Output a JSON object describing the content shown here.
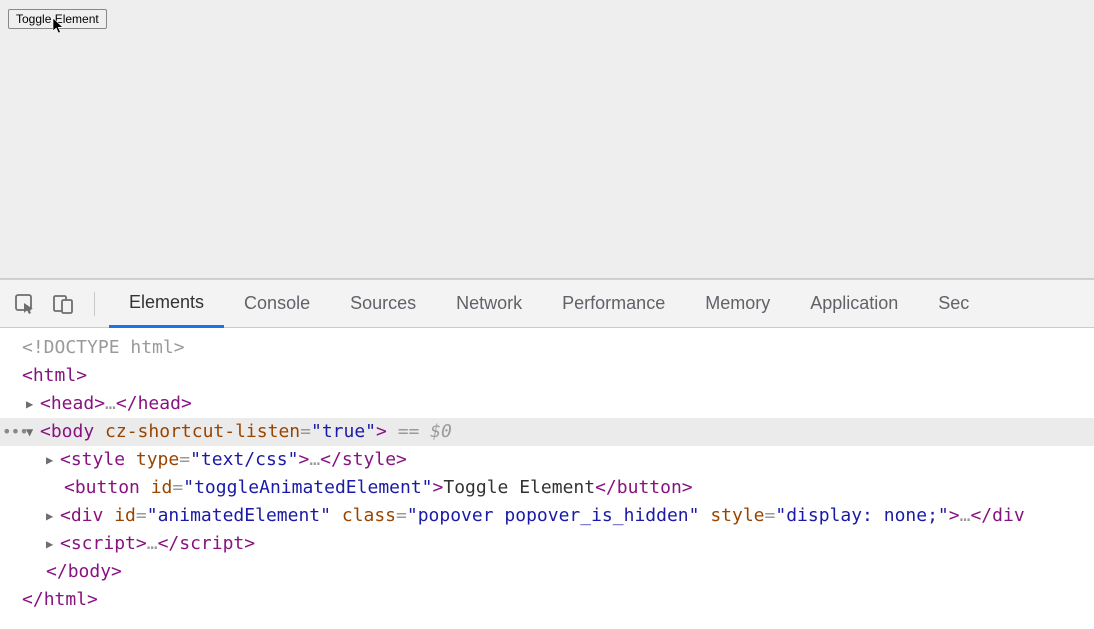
{
  "page": {
    "toggle_button_label": "Toggle Element"
  },
  "devtools": {
    "tabs": {
      "elements": "Elements",
      "console": "Console",
      "sources": "Sources",
      "network": "Network",
      "performance": "Performance",
      "memory": "Memory",
      "application": "Application",
      "security_partial": "Sec"
    },
    "active_tab": "Elements"
  },
  "dom": {
    "doctype": "<!DOCTYPE html>",
    "html_open": "html",
    "head_open": "head",
    "head_ellipsis": "…",
    "head_close": "head",
    "body_open": "body",
    "body_attr_name": "cz-shortcut-listen",
    "body_attr_value": "true",
    "selected_marker": " == $0",
    "style_tag": "style",
    "style_attr_name": "type",
    "style_attr_value": "text/css",
    "style_ellipsis": "…",
    "button_tag": "button",
    "button_id_attr": "id",
    "button_id_value": "toggleAnimatedElement",
    "button_text": "Toggle Element",
    "div_tag": "div",
    "div_id_attr": "id",
    "div_id_value": "animatedElement",
    "div_class_attr": "class",
    "div_class_value": "popover popover_is_hidden",
    "div_style_attr": "style",
    "div_style_value": "display: none;",
    "div_ellipsis": "…",
    "script_tag": "script",
    "script_ellipsis": "…",
    "body_close": "body",
    "html_close": "html"
  }
}
